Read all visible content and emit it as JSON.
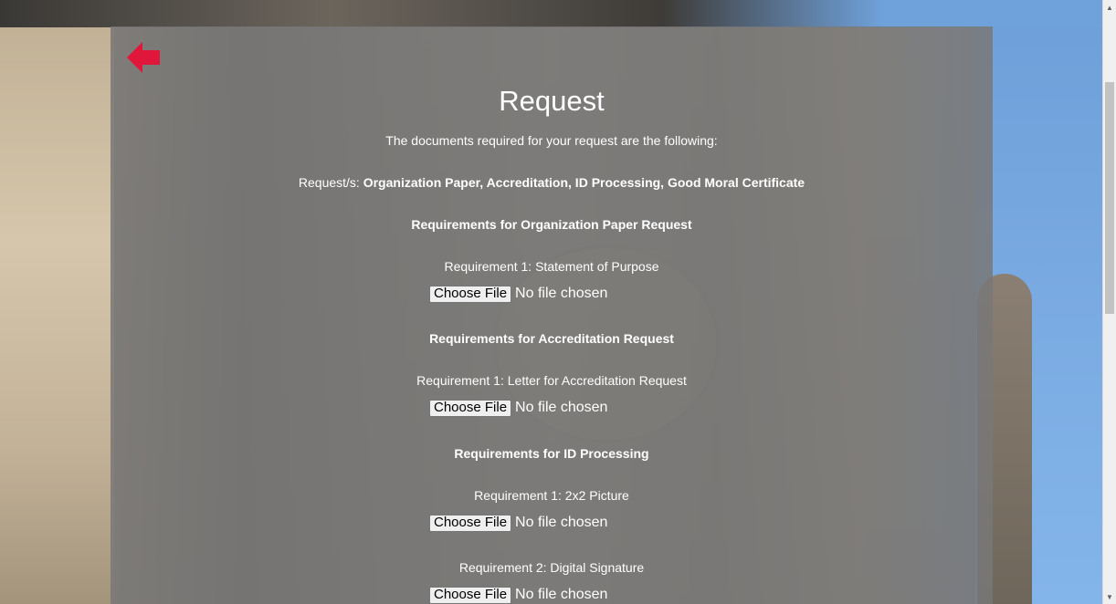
{
  "page": {
    "title": "Request",
    "intro": "The documents required for your request are the following:",
    "requests_label": "Request/s:",
    "requests_value": "Organization Paper, Accreditation, ID Processing, Good Moral Certificate"
  },
  "sections": [
    {
      "heading": "Requirements for Organization Paper Request",
      "requirements": [
        {
          "label": "Requirement 1: Statement of Purpose",
          "button": "Choose File",
          "status": "No file chosen"
        }
      ]
    },
    {
      "heading": "Requirements for Accreditation Request",
      "requirements": [
        {
          "label": "Requirement 1: Letter for Accreditation Request",
          "button": "Choose File",
          "status": "No file chosen"
        }
      ]
    },
    {
      "heading": "Requirements for ID Processing",
      "requirements": [
        {
          "label": "Requirement 1: 2x2 Picture",
          "button": "Choose File",
          "status": "No file chosen"
        },
        {
          "label": "Requirement 2: Digital Signature",
          "button": "Choose File",
          "status": "No file chosen"
        }
      ]
    }
  ],
  "icons": {
    "back": "arrow-left-icon"
  },
  "colors": {
    "back_arrow": "#e0173a",
    "panel": "#787878",
    "text": "#ffffff"
  }
}
